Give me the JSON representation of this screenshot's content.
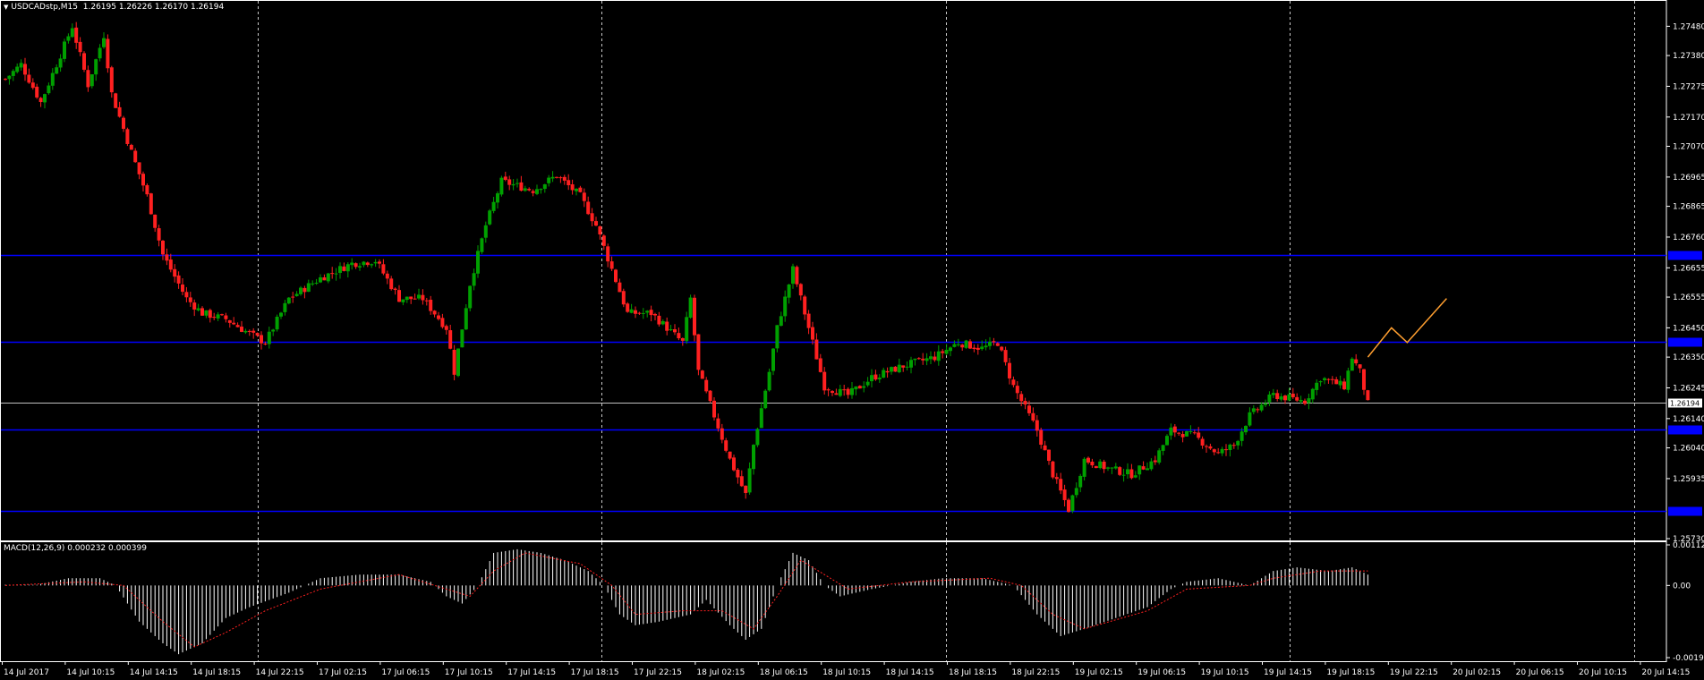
{
  "header": {
    "dropdown_glyph": "▼",
    "symbol": "USDCADstp,M15",
    "ohlc": "1.26195 1.26226 1.26170 1.26194"
  },
  "macd_header": "MACD(12,26,9) 0.000232 0.000399",
  "colors": {
    "background": "#000000",
    "bull": "#00a000",
    "bear": "#ff2020",
    "axis": "#ffffff",
    "grid": "#c8c8c8",
    "level": "#0000ff",
    "current": "#c0c0c0",
    "projection": "#ff9f30",
    "macd_hist": "#ffffff",
    "macd_signal": "#ff2020"
  },
  "chart_data": [
    {
      "type": "candlestick",
      "symbol": "USDCADstp",
      "timeframe": "M15",
      "ylim": [
        1.2573,
        1.2753
      ],
      "y_ticks": [
        "1.27480",
        "1.27380",
        "1.27275",
        "1.27170",
        "1.27070",
        "1.26965",
        "1.26865",
        "1.26760",
        "1.26655",
        "1.26555",
        "1.26450",
        "1.26350",
        "1.26245",
        "1.26140",
        "1.26040",
        "1.25935",
        "1.25730"
      ],
      "x_ticks": [
        "14 Jul 2017",
        "14 Jul 10:15",
        "14 Jul 14:15",
        "14 Jul 18:15",
        "14 Jul 22:15",
        "17 Jul 02:15",
        "17 Jul 06:15",
        "17 Jul 10:15",
        "17 Jul 14:15",
        "17 Jul 18:15",
        "17 Jul 22:15",
        "18 Jul 02:15",
        "18 Jul 06:15",
        "18 Jul 10:15",
        "18 Jul 14:15",
        "18 Jul 18:15",
        "18 Jul 22:15",
        "19 Jul 02:15",
        "19 Jul 06:15",
        "19 Jul 10:15",
        "19 Jul 14:15",
        "19 Jul 18:15",
        "19 Jul 22:15",
        "20 Jul 02:15",
        "20 Jul 06:15",
        "20 Jul 10:15",
        "20 Jul 14:15"
      ],
      "horizontal_levels": [
        1.267,
        1.26402,
        1.26102,
        1.25826
      ],
      "current_price": 1.26194,
      "current_price_label": "1.26194",
      "close_path": [
        [
          0,
          1.273
        ],
        [
          4,
          1.2735
        ],
        [
          9,
          1.2722
        ],
        [
          13,
          1.2735
        ],
        [
          17,
          1.2748
        ],
        [
          21,
          1.2728
        ],
        [
          25,
          1.2745
        ],
        [
          27,
          1.2725
        ],
        [
          32,
          1.2705
        ],
        [
          36,
          1.269
        ],
        [
          40,
          1.267
        ],
        [
          46,
          1.2655
        ],
        [
          50,
          1.265
        ],
        [
          56,
          1.2648
        ],
        [
          62,
          1.2643
        ],
        [
          66,
          1.264
        ],
        [
          72,
          1.2655
        ],
        [
          80,
          1.2662
        ],
        [
          88,
          1.2667
        ],
        [
          94,
          1.2668
        ],
        [
          100,
          1.2655
        ],
        [
          106,
          1.2655
        ],
        [
          112,
          1.2645
        ],
        [
          114,
          1.263
        ],
        [
          118,
          1.266
        ],
        [
          122,
          1.268
        ],
        [
          126,
          1.2695
        ],
        [
          134,
          1.2692
        ],
        [
          140,
          1.2697
        ],
        [
          146,
          1.269
        ],
        [
          150,
          1.268
        ],
        [
          154,
          1.2665
        ],
        [
          158,
          1.265
        ],
        [
          164,
          1.265
        ],
        [
          168,
          1.2645
        ],
        [
          172,
          1.264
        ],
        [
          174,
          1.2655
        ],
        [
          176,
          1.263
        ],
        [
          180,
          1.2615
        ],
        [
          184,
          1.26
        ],
        [
          188,
          1.2588
        ],
        [
          190,
          1.2605
        ],
        [
          194,
          1.263
        ],
        [
          196,
          1.2645
        ],
        [
          200,
          1.2665
        ],
        [
          204,
          1.2645
        ],
        [
          208,
          1.2625
        ],
        [
          214,
          1.2622
        ],
        [
          220,
          1.2628
        ],
        [
          228,
          1.2632
        ],
        [
          236,
          1.2635
        ],
        [
          242,
          1.264
        ],
        [
          248,
          1.2638
        ],
        [
          252,
          1.264
        ],
        [
          256,
          1.2625
        ],
        [
          262,
          1.261
        ],
        [
          266,
          1.2595
        ],
        [
          270,
          1.2583
        ],
        [
          274,
          1.26
        ],
        [
          280,
          1.2597
        ],
        [
          286,
          1.2595
        ],
        [
          292,
          1.26
        ],
        [
          296,
          1.261
        ],
        [
          302,
          1.2608
        ],
        [
          308,
          1.2602
        ],
        [
          312,
          1.2605
        ],
        [
          316,
          1.2615
        ],
        [
          322,
          1.2622
        ],
        [
          330,
          1.262
        ],
        [
          334,
          1.2628
        ],
        [
          340,
          1.2625
        ],
        [
          342,
          1.2635
        ],
        [
          344,
          1.263
        ],
        [
          346,
          1.2619
        ]
      ],
      "projection_path": [
        [
          346,
          1.2635
        ],
        [
          352,
          1.2645
        ],
        [
          356,
          1.264
        ],
        [
          366,
          1.2655
        ]
      ],
      "macd": {
        "ylim": [
          -0.001995,
          0.001121
        ],
        "y_ticks": [
          "0.001121",
          "0.00",
          "-0.001995"
        ],
        "histogram_path": [
          [
            0,
            2e-05
          ],
          [
            8,
            2e-05
          ],
          [
            16,
            0.0002
          ],
          [
            24,
            0.0002
          ],
          [
            28,
            0.0
          ],
          [
            34,
            -0.001
          ],
          [
            40,
            -0.0016
          ],
          [
            44,
            -0.0019
          ],
          [
            50,
            -0.0016
          ],
          [
            56,
            -0.0009
          ],
          [
            62,
            -0.0006
          ],
          [
            72,
            -0.0002
          ],
          [
            80,
            0.0002
          ],
          [
            90,
            0.0003
          ],
          [
            100,
            0.0003
          ],
          [
            108,
            0.0001
          ],
          [
            112,
            -0.0003
          ],
          [
            116,
            -0.0005
          ],
          [
            120,
            0.0
          ],
          [
            124,
            0.0009
          ],
          [
            130,
            0.001
          ],
          [
            136,
            0.0009
          ],
          [
            142,
            0.0007
          ],
          [
            148,
            0.0004
          ],
          [
            152,
            0.0
          ],
          [
            156,
            -0.0008
          ],
          [
            160,
            -0.0011
          ],
          [
            166,
            -0.001
          ],
          [
            174,
            -0.0008
          ],
          [
            178,
            -0.0004
          ],
          [
            184,
            -0.0011
          ],
          [
            188,
            -0.0015
          ],
          [
            192,
            -0.0012
          ],
          [
            196,
            0.0
          ],
          [
            200,
            0.0009
          ],
          [
            204,
            0.0007
          ],
          [
            208,
            0.0
          ],
          [
            212,
            -0.0003
          ],
          [
            220,
            -0.0001
          ],
          [
            230,
            0.0001
          ],
          [
            238,
            0.0002
          ],
          [
            248,
            0.0002
          ],
          [
            256,
            0.0
          ],
          [
            262,
            -0.0008
          ],
          [
            268,
            -0.0014
          ],
          [
            274,
            -0.0012
          ],
          [
            282,
            -0.0009
          ],
          [
            290,
            -0.0006
          ],
          [
            296,
            -0.0001
          ],
          [
            300,
            0.0001
          ],
          [
            308,
            0.0002
          ],
          [
            316,
            0.0
          ],
          [
            322,
            0.0004
          ],
          [
            328,
            0.0005
          ],
          [
            336,
            0.0004
          ],
          [
            342,
            0.0005
          ],
          [
            346,
            0.0003
          ]
        ],
        "signal_path": [
          [
            0,
            0.0
          ],
          [
            20,
            0.0001
          ],
          [
            30,
            0.0
          ],
          [
            40,
            -0.001
          ],
          [
            48,
            -0.0017
          ],
          [
            56,
            -0.0013
          ],
          [
            66,
            -0.0007
          ],
          [
            80,
            -0.0001
          ],
          [
            100,
            0.0003
          ],
          [
            112,
            -0.0001
          ],
          [
            118,
            -0.0003
          ],
          [
            124,
            0.0004
          ],
          [
            132,
            0.0009
          ],
          [
            146,
            0.0006
          ],
          [
            154,
            0.0
          ],
          [
            160,
            -0.0008
          ],
          [
            172,
            -0.0007
          ],
          [
            182,
            -0.0007
          ],
          [
            190,
            -0.0012
          ],
          [
            196,
            -0.0003
          ],
          [
            202,
            0.0007
          ],
          [
            208,
            0.0003
          ],
          [
            214,
            -0.0001
          ],
          [
            230,
            0.0001
          ],
          [
            250,
            0.0002
          ],
          [
            258,
            0.0
          ],
          [
            266,
            -0.0008
          ],
          [
            274,
            -0.0012
          ],
          [
            290,
            -0.0007
          ],
          [
            300,
            -0.0001
          ],
          [
            316,
            0.0
          ],
          [
            322,
            0.0002
          ],
          [
            334,
            0.0004
          ],
          [
            346,
            0.0004
          ]
        ]
      }
    }
  ]
}
